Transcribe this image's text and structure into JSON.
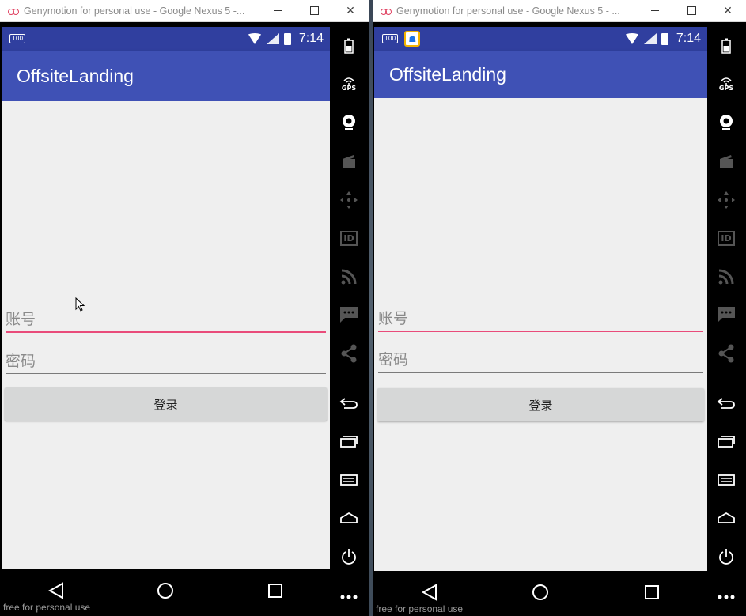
{
  "windows": [
    {
      "title": "Genymotion for personal use - Google Nexus 5 -...",
      "status": {
        "battery_badge": "100",
        "time": "7:14"
      },
      "app_title": "OffsiteLanding",
      "account_placeholder": "账号",
      "password_placeholder": "密码",
      "login_label": "登录",
      "watermark": "free for personal use"
    },
    {
      "title": "Genymotion for personal use - Google Nexus 5 - ...",
      "status": {
        "battery_badge": "100",
        "time": "7:14"
      },
      "app_title": "OffsiteLanding",
      "account_placeholder": "账号",
      "password_placeholder": "密码",
      "login_label": "登录",
      "watermark": "free for personal use"
    }
  ],
  "sidebar": {
    "gps_label": "GPS",
    "id_label": "ID"
  },
  "colors": {
    "status_bar": "#303f9f",
    "app_bar": "#3f51b5",
    "accent": "#e94b7a",
    "content_bg": "#efefef",
    "button_bg": "#d6d7d7"
  }
}
